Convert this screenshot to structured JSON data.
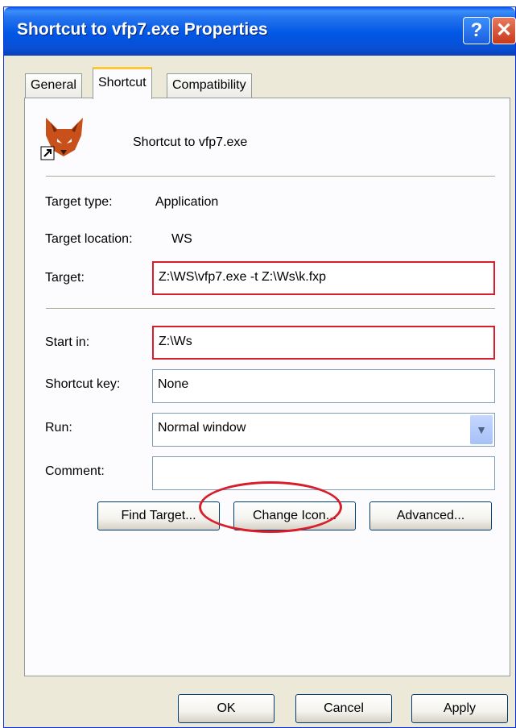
{
  "window": {
    "title": "Shortcut to vfp7.exe Properties"
  },
  "tabs": [
    {
      "label": "General"
    },
    {
      "label": "Shortcut",
      "active": true
    },
    {
      "label": "Compatibility"
    }
  ],
  "header": {
    "icon": "fox-application-icon",
    "name": "Shortcut to vfp7.exe"
  },
  "info": {
    "target_type_label": "Target type:",
    "target_type_value": "Application",
    "target_location_label": "Target location:",
    "target_location_value": "WS"
  },
  "fields": {
    "target_label": "Target:",
    "target_value": "Z:\\WS\\vfp7.exe -t Z:\\Ws\\k.fxp",
    "start_in_label": "Start in:",
    "start_in_value": "Z:\\Ws",
    "shortcut_key_label": "Shortcut key:",
    "shortcut_key_value": "None",
    "run_label": "Run:",
    "run_value": "Normal window",
    "comment_label": "Comment:",
    "comment_value": ""
  },
  "buttons": {
    "find_target": "Find Target...",
    "change_icon": "Change Icon...",
    "advanced": "Advanced..."
  },
  "footer": {
    "ok": "OK",
    "cancel": "Cancel",
    "apply": "Apply"
  },
  "colors": {
    "highlight": "#d81e2a",
    "titlebar": "#0057e5"
  }
}
